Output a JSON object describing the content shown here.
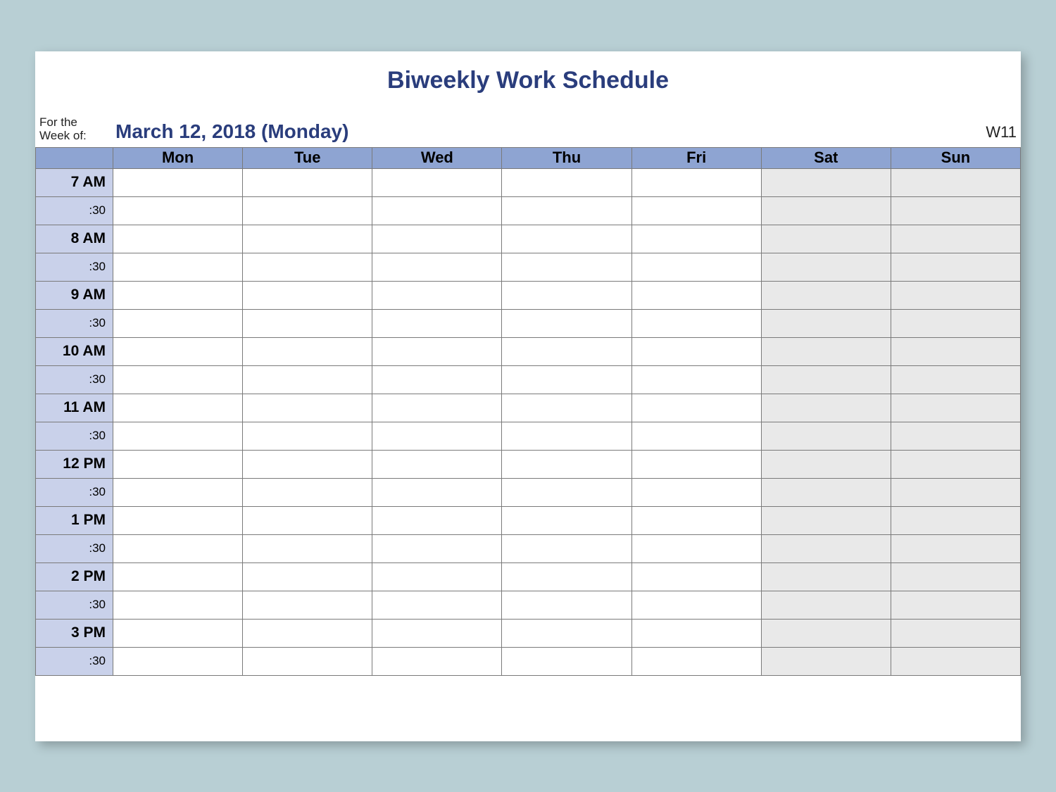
{
  "title": "Biweekly Work Schedule",
  "for_label_1": "For the",
  "for_label_2": "Week of:",
  "week_date": "March 12, 2018 (Monday)",
  "week_number": "W11",
  "days": [
    "Mon",
    "Tue",
    "Wed",
    "Thu",
    "Fri",
    "Sat",
    "Sun"
  ],
  "weekend_indices": [
    5,
    6
  ],
  "time_rows": [
    {
      "label": "7 AM",
      "type": "hour"
    },
    {
      "label": ":30",
      "type": "half"
    },
    {
      "label": "8 AM",
      "type": "hour"
    },
    {
      "label": ":30",
      "type": "half"
    },
    {
      "label": "9 AM",
      "type": "hour"
    },
    {
      "label": ":30",
      "type": "half"
    },
    {
      "label": "10 AM",
      "type": "hour"
    },
    {
      "label": ":30",
      "type": "half"
    },
    {
      "label": "11 AM",
      "type": "hour"
    },
    {
      "label": ":30",
      "type": "half"
    },
    {
      "label": "12 PM",
      "type": "hour"
    },
    {
      "label": ":30",
      "type": "half"
    },
    {
      "label": "1 PM",
      "type": "hour"
    },
    {
      "label": ":30",
      "type": "half"
    },
    {
      "label": "2 PM",
      "type": "hour"
    },
    {
      "label": ":30",
      "type": "half"
    },
    {
      "label": "3 PM",
      "type": "hour"
    },
    {
      "label": ":30",
      "type": "half"
    }
  ]
}
